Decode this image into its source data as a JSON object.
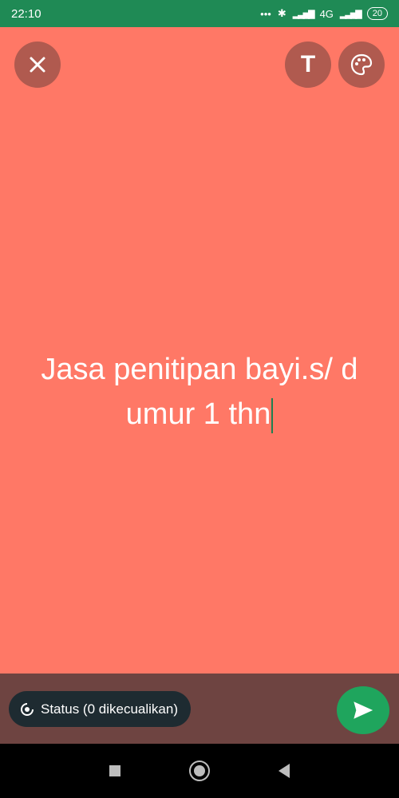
{
  "statusbar": {
    "time": "22:10",
    "network": "4G",
    "battery": "20",
    "icons": [
      "more-dots-icon",
      "bluetooth-icon",
      "signal-icon",
      "signal-icon",
      "battery-icon"
    ]
  },
  "toolbar": {
    "close_icon": "close-icon",
    "text_tool_label": "T",
    "palette_icon": "palette-icon"
  },
  "composer": {
    "text": "Jasa penitipan bayi.s/ d umur 1 thn",
    "background_color": "#ff7866",
    "text_color": "#ffffff",
    "caret_color": "#1e7f4f"
  },
  "footer": {
    "audience_label": "Status (0 dikecualikan)",
    "audience_icon": "status-icon",
    "send_icon": "send-icon"
  },
  "navbar": {
    "icons": [
      "recent-apps-icon",
      "home-icon",
      "back-icon"
    ]
  }
}
